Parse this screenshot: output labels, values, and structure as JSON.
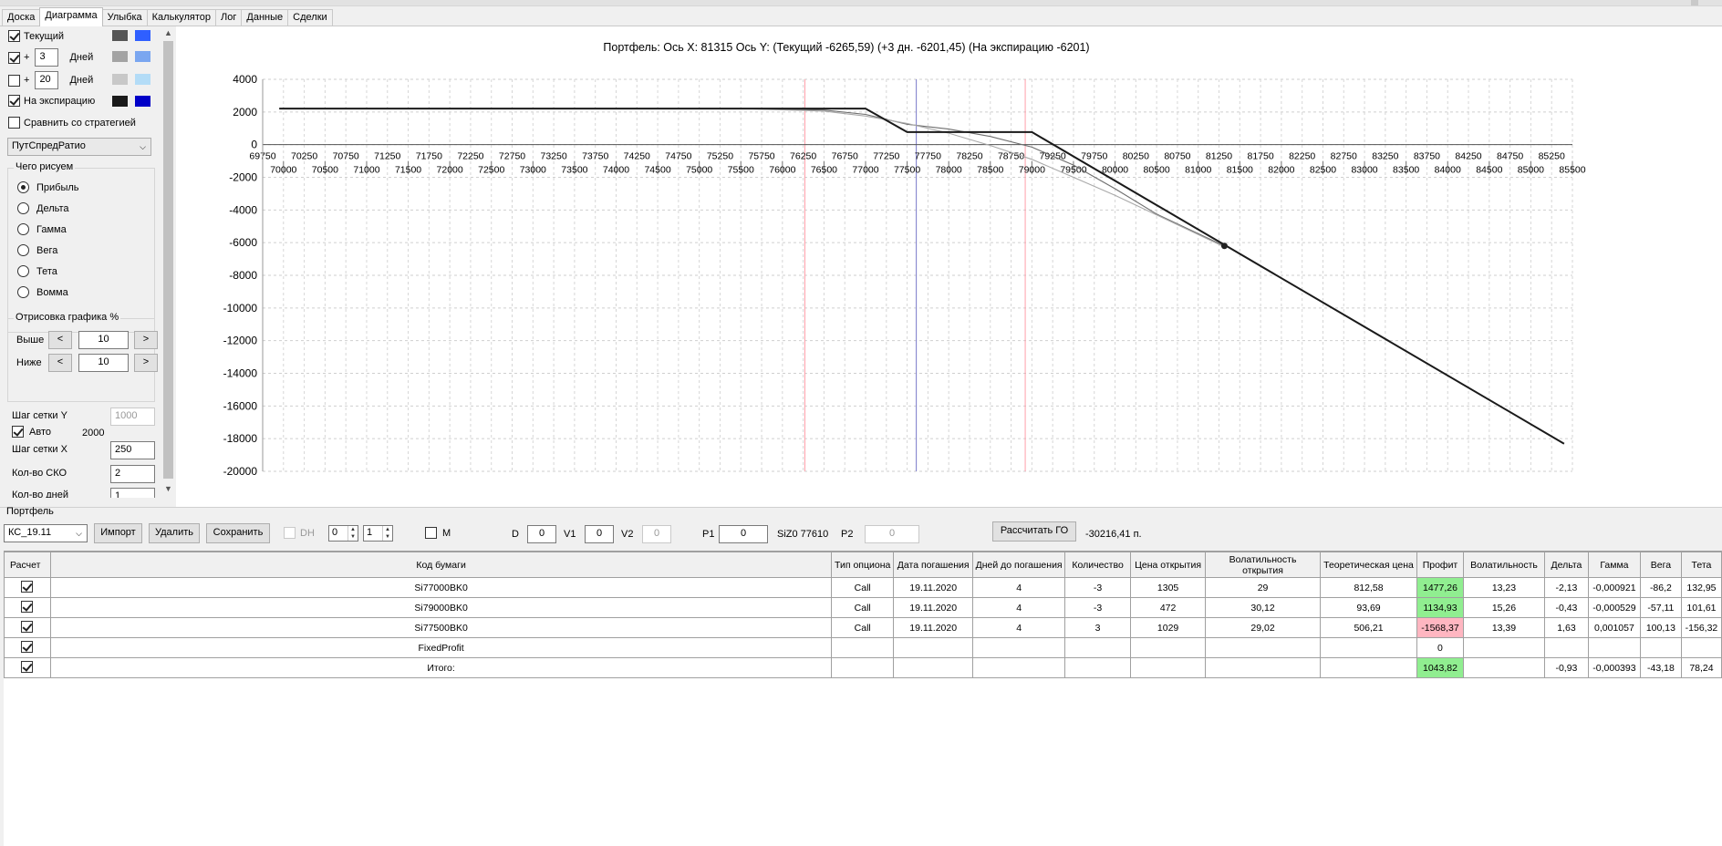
{
  "tabs": [
    "Доска",
    "Диаграмма",
    "Улыбка",
    "Калькулятор",
    "Лог",
    "Данные",
    "Сделки"
  ],
  "active_tab": "Диаграмма",
  "left_panel": {
    "series": [
      {
        "label": "Текущий",
        "checked": true,
        "color1": "#555555",
        "color2": "#2f5fff"
      },
      {
        "label": "Дней",
        "prefix": "+",
        "days": "3",
        "checked": true,
        "color1": "#a3a3a3",
        "color2": "#7aa6f0"
      },
      {
        "label": "Дней",
        "prefix": "+",
        "days": "20",
        "checked": false,
        "color1": "#c8c8c8",
        "color2": "#b3dcf7"
      },
      {
        "label": "На экспирацию",
        "checked": true,
        "color1": "#1a1a1a",
        "color2": "#0000c8"
      }
    ],
    "compare_label": "Сравнить со стратегией",
    "strategy_select": "ПутСпредРатио",
    "draw_group": {
      "title": "Чего рисуем",
      "options": [
        "Прибыль",
        "Дельта",
        "Гамма",
        "Вега",
        "Тета",
        "Вомма"
      ],
      "selected": "Прибыль"
    },
    "render_group": {
      "title": "Отрисовка графика %",
      "above_label": "Выше",
      "above_value": "10",
      "below_label": "Ниже",
      "below_value": "10",
      "dec": "<",
      "inc": ">"
    },
    "grid_y_label": "Шаг сетки Y",
    "grid_y_value": "1000",
    "auto_label": "Авто",
    "auto_value": "2000",
    "grid_x_label": "Шаг сетки X",
    "grid_x_value": "250",
    "sko_label": "Кол-во СКО",
    "sko_value": "2",
    "days_label": "Кол-во дней",
    "days_value": "1"
  },
  "chart_data": {
    "type": "line",
    "title": "Портфель: Ось X: 81315 Ось Y:  (Текущий -6265,59)  (+3 дн. -6201,45)  (На экспирацию -6201)",
    "xlim": [
      69750,
      85500
    ],
    "ylim": [
      -20000,
      4000
    ],
    "yticks": [
      4000,
      2000,
      0,
      -2000,
      -4000,
      -6000,
      -8000,
      -10000,
      -12000,
      -14000,
      -16000,
      -18000,
      -20000
    ],
    "xticks_upper": [
      69750,
      70250,
      70750,
      71250,
      71750,
      72250,
      72750,
      73250,
      73750,
      74250,
      74750,
      75250,
      75750,
      76250,
      76750,
      77250,
      77750,
      78250,
      78750,
      79250,
      79750,
      80250,
      80750,
      81250,
      81750,
      82250,
      82750,
      83250,
      83750,
      84250,
      84750,
      85250
    ],
    "xticks_lower": [
      70000,
      70500,
      71000,
      71500,
      72000,
      72500,
      73000,
      73500,
      74000,
      74500,
      75000,
      75500,
      76000,
      76500,
      77000,
      77500,
      78000,
      78500,
      79000,
      79500,
      80000,
      80500,
      81000,
      81500,
      82000,
      82500,
      83000,
      83500,
      84000,
      84500,
      85000,
      85500
    ],
    "grid": true,
    "vlines": [
      {
        "x": 76270,
        "color": "#ff9ea8"
      },
      {
        "x": 77610,
        "color": "#7878c8"
      },
      {
        "x": 78920,
        "color": "#ff9ea8"
      }
    ],
    "series": [
      {
        "color": "#1a1a1a",
        "x": [
          69950,
          77000,
          77500,
          79000,
          85400
        ],
        "y": [
          2210,
          2210,
          770,
          770,
          -18310
        ]
      },
      {
        "color": "#a9a9a9",
        "x": [
          69950,
          75500,
          76500,
          77000,
          77500,
          78000,
          78500,
          79000,
          79500,
          80000,
          80500,
          81315
        ],
        "y": [
          2210,
          2210,
          2050,
          1750,
          1300,
          700,
          -50,
          -900,
          -2000,
          -3100,
          -4300,
          -6265.59
        ]
      },
      {
        "color": "#6e6e6e",
        "x": [
          69950,
          75500,
          76500,
          77000,
          77500,
          78000,
          78500,
          79000,
          79500,
          80000,
          80500,
          81315
        ],
        "y": [
          2210,
          2210,
          2120,
          1850,
          1250,
          950,
          500,
          -150,
          -1250,
          -2700,
          -4250,
          -6201.45
        ]
      }
    ],
    "marker": {
      "x": 81315,
      "y": -6201
    }
  },
  "bottom": {
    "portfolio_label": "Портфель",
    "portfolio_select": "КС_19.11",
    "import_btn": "Импорт",
    "delete_btn": "Удалить",
    "save_btn": "Сохранить",
    "dh_label": "DH",
    "spin1": "0",
    "spin2": "1",
    "m_label": "M",
    "d_label": "D",
    "d_value": "0",
    "v1_label": "V1",
    "v1_value": "0",
    "v2_label": "V2",
    "v2_value": "0",
    "p1_label": "P1",
    "p1_value": "0",
    "siz_label": "SiZ0 77610",
    "p2_label": "P2",
    "p2_value": "0",
    "calc_go_btn": "Рассчитать ГО",
    "go_value": "-30216,41 п."
  },
  "table": {
    "headers": [
      "Расчет",
      "Код бумаги",
      "Тип опциона",
      "Дата погашения",
      "Дней до погашения",
      "Количество",
      "Цена открытия",
      "Волатильность открытия",
      "Теоретическая цена",
      "Профит",
      "Волатильность",
      "Дельта",
      "Гамма",
      "Вега",
      "Тета"
    ],
    "rows": [
      {
        "check": true,
        "code": "Si77000BK0",
        "type": "Call",
        "date": "19.11.2020",
        "days": "4",
        "qty": "-3",
        "open": "1305",
        "vol_open": "29",
        "theo": "812,58",
        "profit": "1477,26",
        "profit_color": "green",
        "vol": "13,23",
        "delta": "-2,13",
        "gamma": "-0,000921",
        "vega": "-86,2",
        "theta": "132,95"
      },
      {
        "check": true,
        "code": "Si79000BK0",
        "type": "Call",
        "date": "19.11.2020",
        "days": "4",
        "qty": "-3",
        "open": "472",
        "vol_open": "30,12",
        "theo": "93,69",
        "profit": "1134,93",
        "profit_color": "green",
        "vol": "15,26",
        "delta": "-0,43",
        "gamma": "-0,000529",
        "vega": "-57,11",
        "theta": "101,61"
      },
      {
        "check": true,
        "code": "Si77500BK0",
        "type": "Call",
        "date": "19.11.2020",
        "days": "4",
        "qty": "3",
        "open": "1029",
        "vol_open": "29,02",
        "theo": "506,21",
        "profit": "-1568,37",
        "profit_color": "red",
        "vol": "13,39",
        "delta": "1,63",
        "gamma": "0,001057",
        "vega": "100,13",
        "theta": "-156,32"
      },
      {
        "check": true,
        "code": "FixedProfit",
        "type": "",
        "date": "",
        "days": "",
        "qty": "",
        "open": "",
        "vol_open": "",
        "theo": "",
        "profit": "0",
        "profit_color": "",
        "vol": "",
        "delta": "",
        "gamma": "",
        "vega": "",
        "theta": ""
      },
      {
        "check": true,
        "code": "Итого:",
        "type": "",
        "date": "",
        "days": "",
        "qty": "",
        "open": "",
        "vol_open": "",
        "theo": "",
        "profit": "1043,82",
        "profit_color": "green",
        "vol": "",
        "delta": "-0,93",
        "gamma": "-0,000393",
        "vega": "-43,18",
        "theta": "78,24"
      }
    ]
  }
}
